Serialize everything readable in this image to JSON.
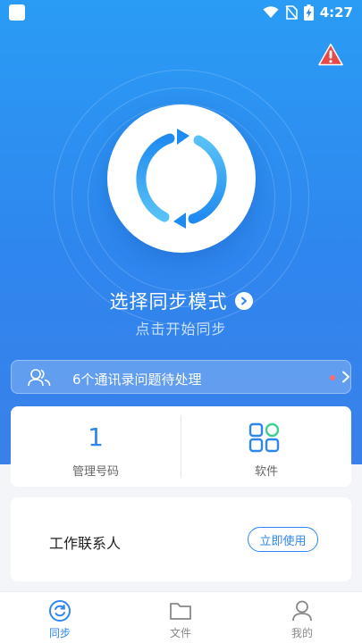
{
  "statusbar": {
    "time": "4:27"
  },
  "sync": {
    "mode_title": "选择同步模式",
    "subtitle": "点击开始同步"
  },
  "issues": {
    "text": "6个通讯录问题待处理"
  },
  "stats": {
    "managed_count": "1",
    "managed_label": "管理号码",
    "apps_label": "软件"
  },
  "contact_card": {
    "title": "工作联系人",
    "button_label": "立即使用"
  },
  "tabbar": {
    "tabs": [
      {
        "label": "同步",
        "icon": "sync-icon",
        "active": true
      },
      {
        "label": "文件",
        "icon": "folder-icon",
        "active": false
      },
      {
        "label": "我的",
        "icon": "person-icon",
        "active": false
      }
    ]
  },
  "colors": {
    "brand_blue": "#2f86ee",
    "hero_top": "#2a9cf5",
    "warning_red": "#e84a4a"
  }
}
